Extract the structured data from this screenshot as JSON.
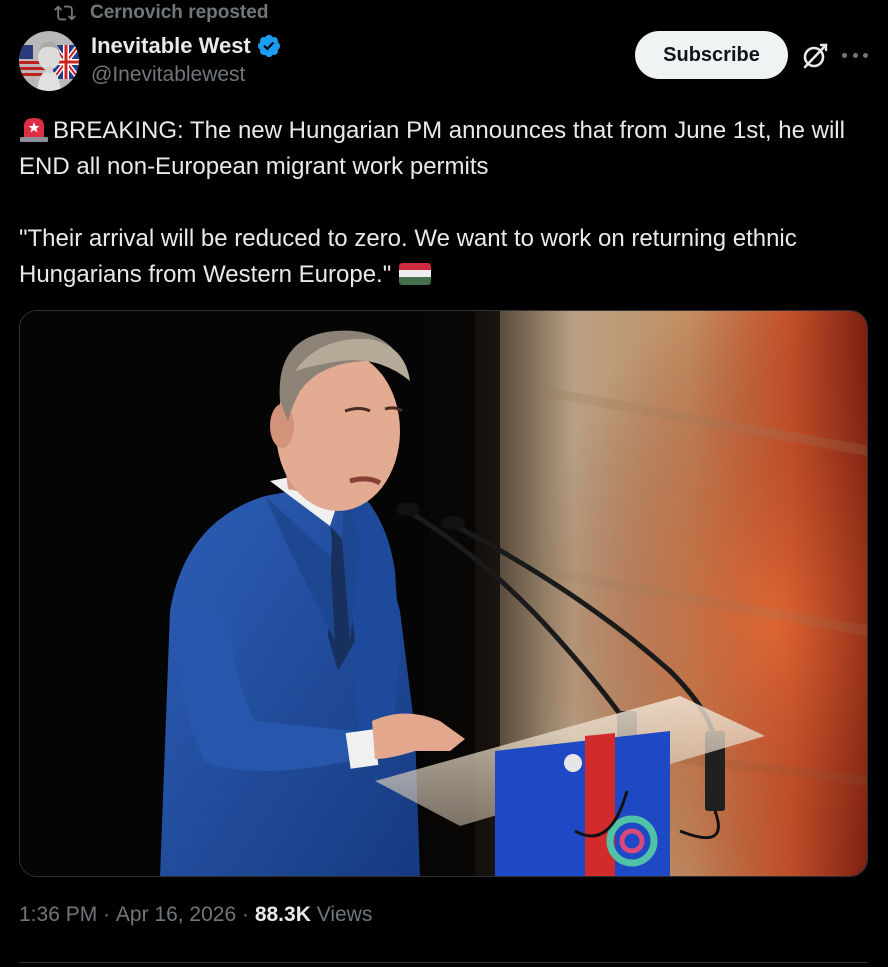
{
  "repost": {
    "text": "Cernovich reposted"
  },
  "author": {
    "display_name": "Inevitable West",
    "handle": "@Inevitablewest",
    "verified": true,
    "verified_color": "#1d9bf0"
  },
  "actions": {
    "subscribe_label": "Subscribe",
    "grok_icon": "grok-icon",
    "more_icon": "more-horizontal-icon"
  },
  "tweet": {
    "line1": "BREAKING: The new Hungarian PM announces that from June 1st, he will END all non-European migrant work permits",
    "line2": "\"Their arrival will be reduced to zero. We want to work on returning ethnic Hungarians from Western Europe.\"",
    "emoji_start": "rotating-light-emoji",
    "emoji_end": "hungary-flag-emoji"
  },
  "meta": {
    "time": "1:36 PM",
    "separator": " · ",
    "date": "Apr 16, 2026",
    "views_count": "88.3K",
    "views_label": " Views"
  },
  "colors": {
    "background": "#000000",
    "text_primary": "#e7e9ea",
    "text_secondary": "#71767b",
    "subscribe_bg": "#eff3f4",
    "border": "#2f3336"
  }
}
